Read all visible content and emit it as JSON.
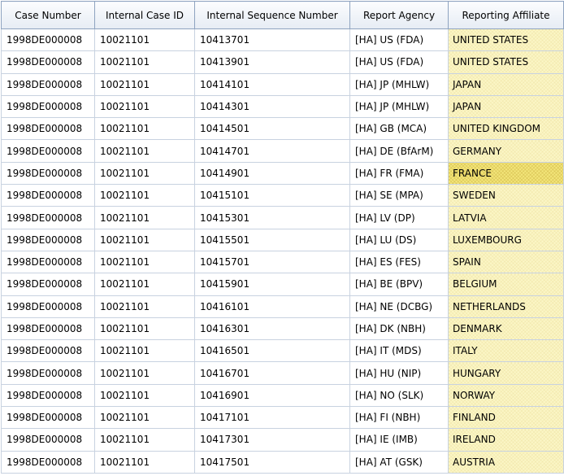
{
  "columns": [
    "Case Number",
    "Internal Case ID",
    "Internal Sequence Number",
    "Report Agency",
    "Reporting Affiliate"
  ],
  "selected_row": 6,
  "colors": {
    "header_border": "#8ea3c0",
    "affiliate_bg": "#fbf6c6",
    "selected_affiliate_bg": "#f3e67a"
  },
  "rows": [
    [
      "1998DE000008",
      "10021101",
      "10413701",
      "[HA] US (FDA)",
      "UNITED STATES"
    ],
    [
      "1998DE000008",
      "10021101",
      "10413901",
      "[HA] US (FDA)",
      "UNITED STATES"
    ],
    [
      "1998DE000008",
      "10021101",
      "10414101",
      "[HA] JP (MHLW)",
      "JAPAN"
    ],
    [
      "1998DE000008",
      "10021101",
      "10414301",
      "[HA] JP (MHLW)",
      "JAPAN"
    ],
    [
      "1998DE000008",
      "10021101",
      "10414501",
      "[HA] GB (MCA)",
      "UNITED KINGDOM"
    ],
    [
      "1998DE000008",
      "10021101",
      "10414701",
      "[HA] DE (BfArM)",
      "GERMANY"
    ],
    [
      "1998DE000008",
      "10021101",
      "10414901",
      "[HA] FR (FMA)",
      "FRANCE"
    ],
    [
      "1998DE000008",
      "10021101",
      "10415101",
      "[HA] SE (MPA)",
      "SWEDEN"
    ],
    [
      "1998DE000008",
      "10021101",
      "10415301",
      "[HA] LV (DP)",
      "LATVIA"
    ],
    [
      "1998DE000008",
      "10021101",
      "10415501",
      "[HA] LU (DS)",
      "LUXEMBOURG"
    ],
    [
      "1998DE000008",
      "10021101",
      "10415701",
      "[HA] ES (FES)",
      "SPAIN"
    ],
    [
      "1998DE000008",
      "10021101",
      "10415901",
      "[HA] BE (BPV)",
      "BELGIUM"
    ],
    [
      "1998DE000008",
      "10021101",
      "10416101",
      "[HA] NE (DCBG)",
      "NETHERLANDS"
    ],
    [
      "1998DE000008",
      "10021101",
      "10416301",
      "[HA] DK (NBH)",
      "DENMARK"
    ],
    [
      "1998DE000008",
      "10021101",
      "10416501",
      "[HA] IT (MDS)",
      "ITALY"
    ],
    [
      "1998DE000008",
      "10021101",
      "10416701",
      "[HA] HU (NIP)",
      "HUNGARY"
    ],
    [
      "1998DE000008",
      "10021101",
      "10416901",
      "[HA] NO (SLK)",
      "NORWAY"
    ],
    [
      "1998DE000008",
      "10021101",
      "10417101",
      "[HA] FI (NBH)",
      "FINLAND"
    ],
    [
      "1998DE000008",
      "10021101",
      "10417301",
      "[HA] IE (IMB)",
      "IRELAND"
    ],
    [
      "1998DE000008",
      "10021101",
      "10417501",
      "[HA] AT (GSK)",
      "AUSTRIA"
    ]
  ]
}
